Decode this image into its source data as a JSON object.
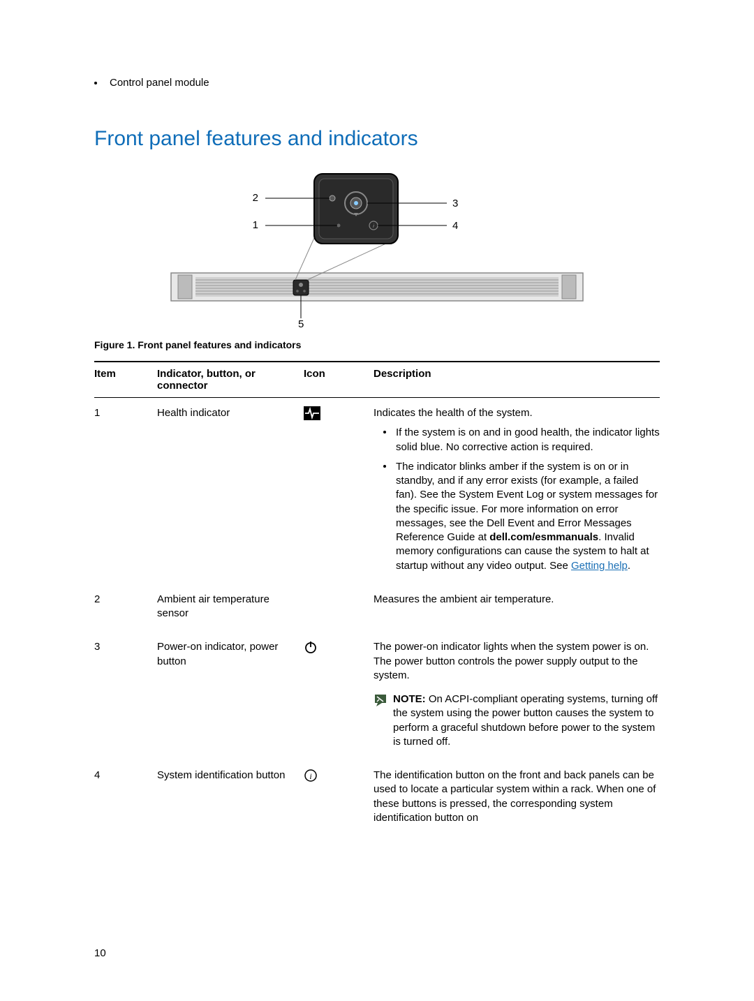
{
  "top_bullet": "Control panel module",
  "heading": "Front panel features and indicators",
  "figure_caption": "Figure 1. Front panel features and indicators",
  "table": {
    "headers": {
      "item": "Item",
      "indicator": "Indicator, button, or connector",
      "icon": "Icon",
      "desc": "Description"
    },
    "rows": [
      {
        "item": "1",
        "indicator": "Health indicator",
        "desc_intro": "Indicates the health of the system.",
        "bullet1": "If the system is on and in good health, the indicator lights solid blue. No corrective action is required.",
        "bullet2_a": "The indicator blinks amber if the system is on or in standby, and if any error exists (for example, a failed fan). See the System Event Log or system messages for the specific issue. For more information on error messages, see the Dell Event and Error Messages Reference Guide at ",
        "bullet2_bold": "dell.com/esmmanuals",
        "bullet2_b": ". Invalid memory configurations can cause the system to halt at startup without any video output. See ",
        "bullet2_link": "Getting help",
        "bullet2_end": "."
      },
      {
        "item": "2",
        "indicator": "Ambient air temperature sensor",
        "desc": "Measures the ambient air temperature."
      },
      {
        "item": "3",
        "indicator": "Power-on indicator, power button",
        "desc": "The power-on indicator lights when the system power is on. The power button controls the power supply output to the system.",
        "note_label": "NOTE:",
        "note_text": " On ACPI-compliant operating systems, turning off the system using the power button causes the system to perform a graceful shutdown before power to the system is turned off."
      },
      {
        "item": "4",
        "indicator": "System identification button",
        "desc": "The identification button on the front and back panels can be used to locate a particular system within a rack. When one of these buttons is pressed, the corresponding system identification button on"
      }
    ]
  },
  "page_number": "10",
  "callouts": {
    "c1": "1",
    "c2": "2",
    "c3": "3",
    "c4": "4",
    "c5": "5"
  }
}
